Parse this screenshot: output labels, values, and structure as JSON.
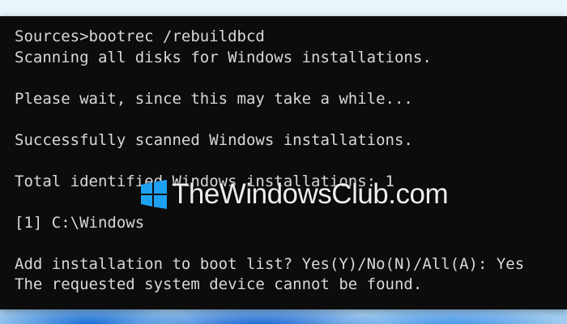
{
  "terminal": {
    "lines": [
      "Sources>bootrec /rebuildbcd",
      "Scanning all disks for Windows installations.",
      "",
      "Please wait, since this may take a while...",
      "",
      "Successfully scanned Windows installations.",
      "",
      "Total identified Windows installations: 1",
      "",
      "[1] C:\\Windows",
      "",
      "Add installation to boot list? Yes(Y)/No(N)/All(A): Yes",
      "The requested system device cannot be found."
    ]
  },
  "watermark": {
    "text": "TheWindowsClub.com",
    "logo_icon": "windows-logo-icon",
    "logo_color": "#1ea1f1"
  },
  "colors": {
    "terminal_background": "#0c0c0c",
    "terminal_text": "#d8d8d8"
  }
}
